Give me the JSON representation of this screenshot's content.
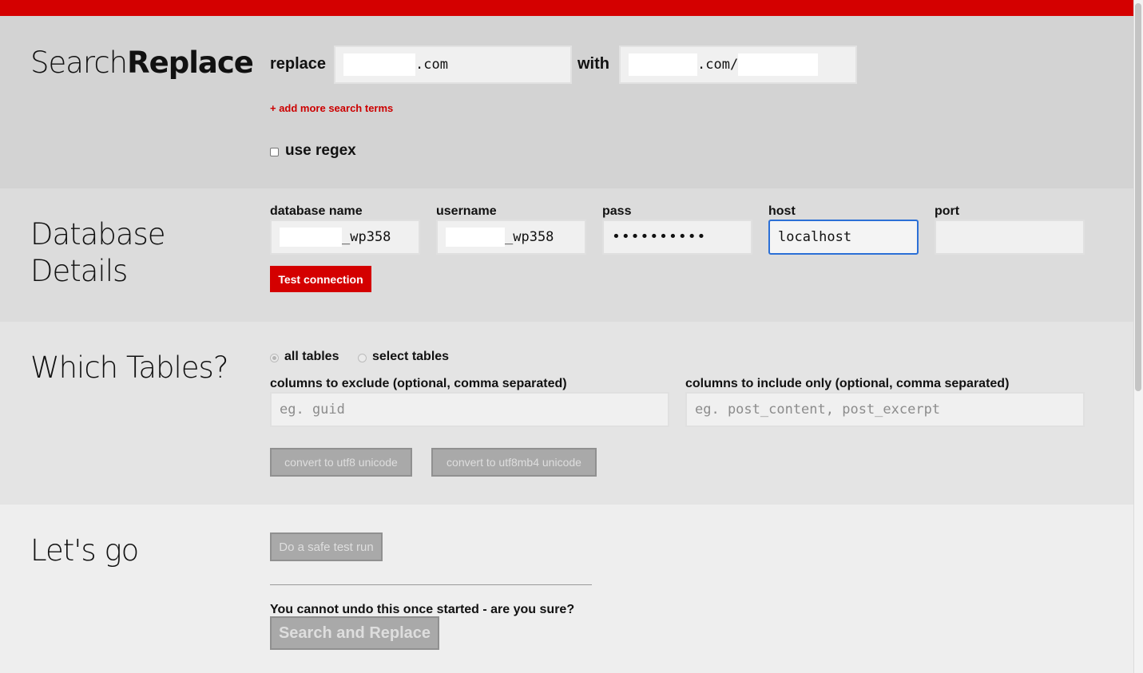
{
  "app": {
    "title_light": "Search",
    "title_bold": "Replace"
  },
  "search": {
    "replace_label": "replace",
    "replace_value": ".com",
    "with_label": "with",
    "with_value": ".com/",
    "add_more_link": "+ add more search terms",
    "use_regex_label": "use regex",
    "use_regex_checked": false
  },
  "database": {
    "heading_line1": "Database",
    "heading_line2": "Details",
    "name_label": "database name",
    "name_value": "_wp358",
    "username_label": "username",
    "username_value": "_wp358",
    "pass_label": "pass",
    "pass_value": "••••••••••",
    "host_label": "host",
    "host_value": "localhost",
    "port_label": "port",
    "port_value": "",
    "test_button": "Test connection"
  },
  "tables": {
    "heading": "Which Tables?",
    "all_tables_label": "all tables",
    "select_tables_label": "select tables",
    "selected_option": "all tables",
    "exclude_label": "columns to exclude (optional, comma separated)",
    "exclude_placeholder": "eg. guid",
    "include_label": "columns to include only (optional, comma separated)",
    "include_placeholder": "eg. post_content, post_excerpt",
    "utf8_button": "convert to utf8 unicode",
    "utf8mb4_button": "convert to utf8mb4 unicode"
  },
  "go": {
    "heading": "Let's go",
    "test_run_button": "Do a safe test run",
    "warning": "You cannot undo this once started - are you sure?",
    "search_replace_button": "Search and Replace"
  },
  "colors": {
    "accent": "#d40000",
    "focus_border": "#2b6fd6",
    "disabled_button": "#a9a9a9"
  }
}
